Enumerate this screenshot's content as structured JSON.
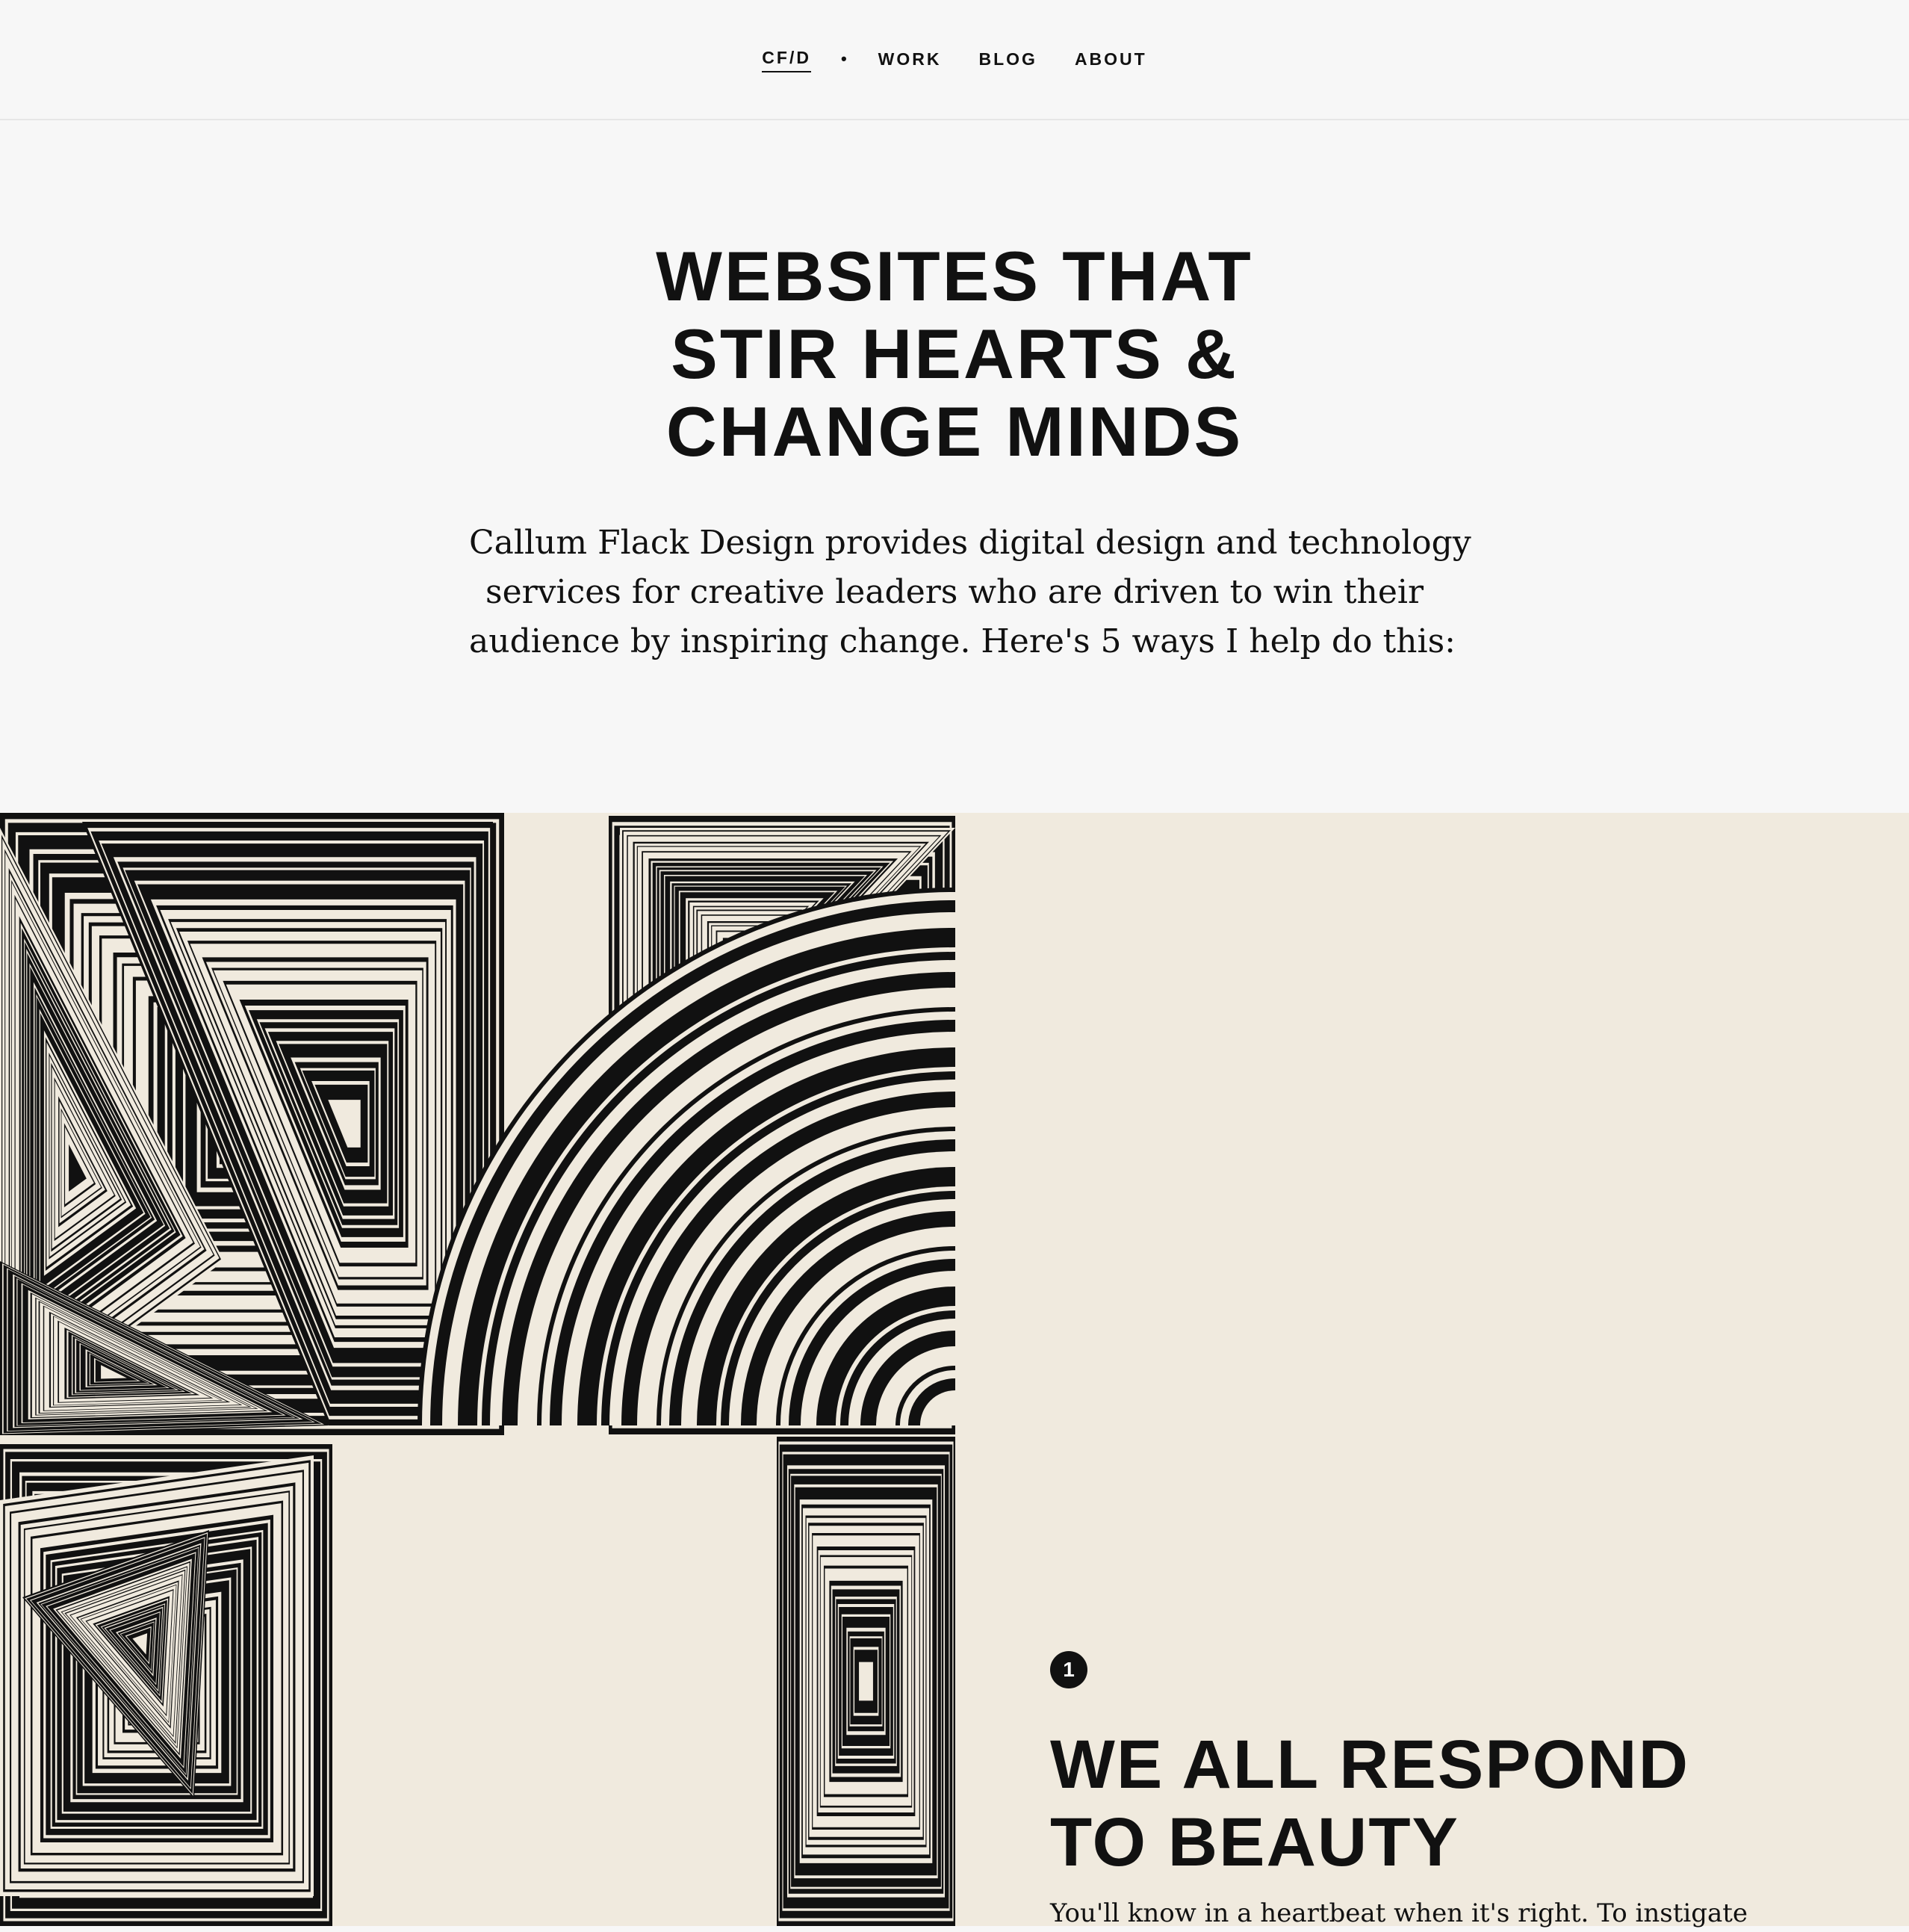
{
  "nav": {
    "logo": "CF/D",
    "separator": "•",
    "items": [
      "WORK",
      "BLOG",
      "ABOUT"
    ]
  },
  "hero": {
    "title_lines": [
      "WEBSITES THAT",
      "STIR HEARTS &",
      "CHANGE MINDS"
    ],
    "subtitle_lines": [
      "Callum Flack Design provides digital design and technology",
      "services for creative leaders who are driven to win their",
      "audience by inspiring change. Here's 5 ways I help do this:"
    ]
  },
  "feature": {
    "step_number": "1",
    "title_lines": [
      "WE ALL RESPOND",
      "TO BEAUTY"
    ],
    "text": "You'll know in a heartbeat when it's right. To instigate"
  },
  "colors": {
    "page_bg": "#f7f7f7",
    "feature_bg": "#f0eade",
    "ink": "#111111",
    "art_light": "#f0eade"
  },
  "icons": {
    "step_badge": "numbered-circle-icon",
    "art": "concentric-line-pattern"
  }
}
